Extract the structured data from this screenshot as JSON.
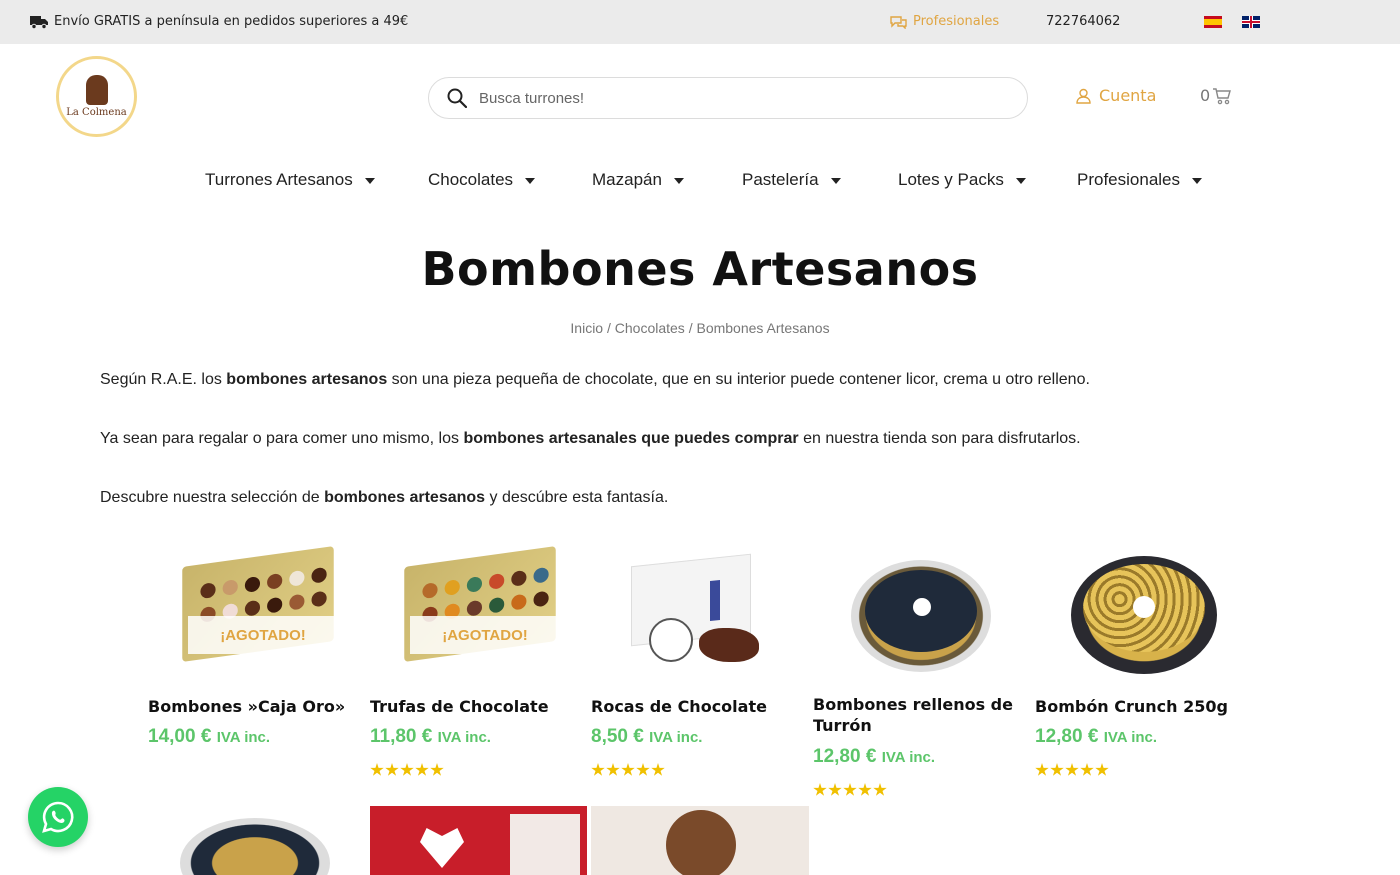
{
  "topbar": {
    "shipping_text": "Envío GRATIS a península en pedidos superiores a 49€",
    "pro_link": "Profesionales",
    "phone": "722764062"
  },
  "logo": {
    "text": "La Colmena"
  },
  "search": {
    "placeholder": "Busca turrones!"
  },
  "header": {
    "account_label": "Cuenta",
    "cart_count": "0"
  },
  "nav": {
    "items": [
      {
        "label": "Turrones Artesanos"
      },
      {
        "label": "Chocolates"
      },
      {
        "label": "Mazapán"
      },
      {
        "label": "Pastelería"
      },
      {
        "label": "Lotes y Packs"
      },
      {
        "label": "Profesionales"
      }
    ]
  },
  "page": {
    "title": "Bombones Artesanos",
    "breadcrumb": [
      "Inicio",
      "Chocolates",
      "Bombones Artesanos"
    ],
    "paragraphs": [
      {
        "pre": "Según R.A.E. los ",
        "bold": "bombones artesanos",
        "post": " son una pieza pequeña de chocolate, que en su interior puede contener licor, crema u otro relleno."
      },
      {
        "pre": "Ya sean para regalar o para comer uno mismo, los ",
        "bold": "bombones artesanales que puedes comprar",
        "post": " en nuestra tienda son para disfrutarlos."
      },
      {
        "pre": "Descubre nuestra selección de ",
        "bold": "bombones artesanos",
        "post": " y descúbre esta fantasía."
      }
    ]
  },
  "products": [
    {
      "name": "Bombones »Caja Oro»",
      "price": "14,00 €",
      "tax": "IVA inc.",
      "badge": "¡AGOTADO!",
      "rating": 0
    },
    {
      "name": "Trufas de Chocolate",
      "price": "11,80 €",
      "tax": "IVA inc.",
      "badge": "¡AGOTADO!",
      "rating": 5
    },
    {
      "name": "Rocas de Chocolate",
      "price": "8,50 €",
      "tax": "IVA inc.",
      "badge": "",
      "rating": 5
    },
    {
      "name": "Bombones rellenos de Turrón",
      "price": "12,80 €",
      "tax": "IVA inc.",
      "badge": "",
      "rating": 5
    },
    {
      "name": "Bombón Crunch 250g",
      "price": "12,80 €",
      "tax": "IVA inc.",
      "badge": "",
      "rating": 5
    }
  ],
  "colors": {
    "accent": "#e0a542",
    "price": "#5cc56a",
    "whatsapp": "#25d366"
  },
  "icons": [
    "truck-icon",
    "chat-icon",
    "search-icon",
    "user-icon",
    "cart-icon",
    "whatsapp-icon"
  ]
}
